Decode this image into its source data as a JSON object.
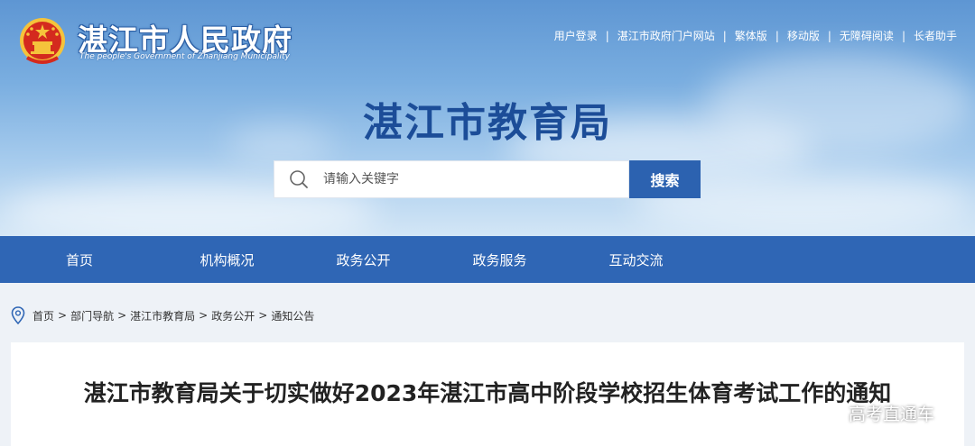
{
  "header": {
    "site_title": "湛江市人民政府",
    "site_subtitle": "The people's Government of Zhanjiang Municipality",
    "top_links": [
      "用户登录",
      "湛江市政府门户网站",
      "繁体版",
      "移动版",
      "无障碍阅读",
      "长者助手"
    ],
    "top_separator": "|"
  },
  "department_title": "湛江市教育局",
  "search": {
    "placeholder": "请输入关键字",
    "button_label": "搜索"
  },
  "nav": {
    "items": [
      "首页",
      "机构概况",
      "政务公开",
      "政务服务",
      "互动交流"
    ]
  },
  "breadcrumb": {
    "items": [
      "首页",
      "部门导航",
      "湛江市教育局",
      "政务公开",
      "通知公告"
    ],
    "separator": ">"
  },
  "article": {
    "title": "湛江市教育局关于切实做好2023年湛江市高中阶段学校招生体育考试工作的通知"
  },
  "watermark": "高考直通车",
  "colors": {
    "nav_bg": "#2f66b5",
    "search_button": "#2c62b0",
    "dept_title": "#1c4d98",
    "emblem_red": "#d42a1e",
    "emblem_gold": "#f5c33b"
  }
}
